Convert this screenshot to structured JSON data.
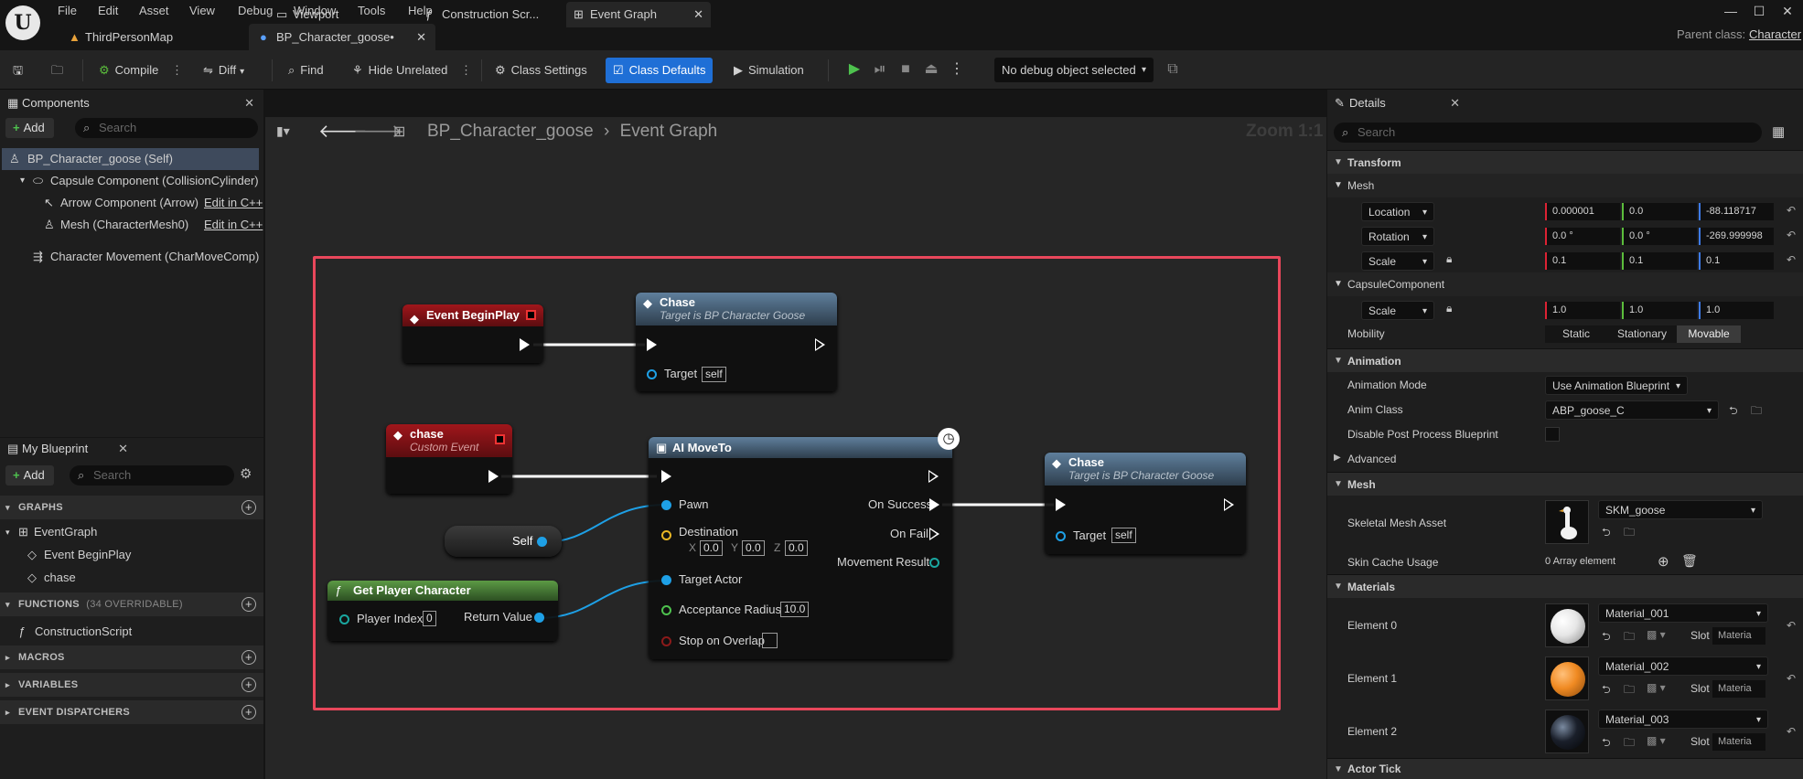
{
  "menu": [
    "File",
    "Edit",
    "Asset",
    "View",
    "Debug",
    "Window",
    "Tools",
    "Help"
  ],
  "tabs": [
    {
      "label": "ThirdPersonMap"
    },
    {
      "label": "BP_Character_goose•"
    }
  ],
  "parent_class": {
    "label": "Parent class:",
    "value": "Character"
  },
  "toolbar": {
    "compile": "Compile",
    "diff": "Diff",
    "find": "Find",
    "hide_unrelated": "Hide Unrelated",
    "class_settings": "Class Settings",
    "class_defaults": "Class Defaults",
    "simulation": "Simulation",
    "debug_object": "No debug object selected"
  },
  "components": {
    "tab": "Components",
    "add": "Add",
    "search_placeholder": "Search",
    "items": [
      {
        "label": "BP_Character_goose (Self)"
      },
      {
        "label": "Capsule Component (CollisionCylinder)"
      },
      {
        "label": "Arrow Component (Arrow)",
        "edit": "Edit in C++"
      },
      {
        "label": "Mesh (CharacterMesh0)",
        "edit": "Edit in C++"
      },
      {
        "label": "Character Movement (CharMoveComp)"
      }
    ]
  },
  "my_blueprint": {
    "tab": "My Blueprint",
    "add": "Add",
    "search_placeholder": "Search",
    "graphs_header": "GRAPHS",
    "event_graph": "EventGraph",
    "graph_items": [
      "Event BeginPlay",
      "chase"
    ],
    "functions_header": "FUNCTIONS",
    "functions_count": "(34 OVERRIDABLE)",
    "construction_script": "ConstructionScript",
    "macros_header": "MACROS",
    "variables_header": "VARIABLES",
    "dispatchers_header": "EVENT DISPATCHERS"
  },
  "graph_tabs": {
    "viewport": "Viewport",
    "construction": "Construction Scr...",
    "event_graph": "Event Graph"
  },
  "breadcrumb": {
    "blueprint": "BP_Character_goose",
    "sep": "›",
    "graph": "Event Graph"
  },
  "zoom": "Zoom 1:1",
  "nodes": {
    "begin_play": {
      "title": "Event BeginPlay"
    },
    "chase_call1": {
      "title": "Chase",
      "subtitle": "Target is BP Character Goose",
      "target_label": "Target",
      "target_value": "self"
    },
    "custom_event": {
      "title": "chase",
      "subtitle": "Custom Event"
    },
    "ai_moveto": {
      "title": "AI MoveTo",
      "pawn": "Pawn",
      "destination": "Destination",
      "dest_x_label": "X",
      "dest_x": "0.0",
      "dest_y_label": "Y",
      "dest_y": "0.0",
      "dest_z_label": "Z",
      "dest_z": "0.0",
      "target_actor": "Target Actor",
      "acceptance_radius": "Acceptance Radius",
      "acceptance_value": "10.0",
      "stop_on_overlap": "Stop on Overlap",
      "on_success": "On Success",
      "on_fail": "On Fail",
      "movement_result": "Movement Result"
    },
    "self_node": {
      "label": "Self"
    },
    "get_player": {
      "title": "Get Player Character",
      "player_index": "Player Index",
      "player_index_value": "0",
      "return_value": "Return Value"
    },
    "chase_call2": {
      "title": "Chase",
      "subtitle": "Target is BP Character Goose",
      "target_label": "Target",
      "target_value": "self"
    }
  },
  "details": {
    "tab": "Details",
    "search_placeholder": "Search",
    "transform": "Transform",
    "mesh_sub": "Mesh",
    "location": {
      "label": "Location",
      "x": "0.000001",
      "y": "0.0",
      "z": "-88.118717"
    },
    "rotation": {
      "label": "Rotation",
      "x": "0.0 °",
      "y": "0.0 °",
      "z": "-269.999998"
    },
    "scale": {
      "label": "Scale",
      "x": "0.1",
      "y": "0.1",
      "z": "0.1"
    },
    "capsule_sub": "CapsuleComponent",
    "capsule_scale": {
      "label": "Scale",
      "x": "1.0",
      "y": "1.0",
      "z": "1.0"
    },
    "mobility": {
      "label": "Mobility",
      "options": [
        "Static",
        "Stationary",
        "Movable"
      ],
      "selected": "Movable"
    },
    "animation": "Animation",
    "animation_mode": {
      "label": "Animation Mode",
      "value": "Use Animation Blueprint"
    },
    "anim_class": {
      "label": "Anim Class",
      "value": "ABP_goose_C"
    },
    "disable_post_process": "Disable Post Process Blueprint",
    "advanced": "Advanced",
    "mesh_section": "Mesh",
    "skeletal_mesh": {
      "label": "Skeletal Mesh Asset",
      "value": "SKM_goose"
    },
    "skin_cache": {
      "label": "Skin Cache Usage",
      "value": "0 Array element"
    },
    "materials": "Materials",
    "elements": [
      {
        "label": "Element 0",
        "value": "Material_001",
        "slot": "Slot",
        "slot_value": "Materia",
        "color": "#e6e6e6"
      },
      {
        "label": "Element 1",
        "value": "Material_002",
        "slot": "Slot",
        "slot_value": "Materia",
        "color": "#f08a22"
      },
      {
        "label": "Element 2",
        "value": "Material_003",
        "slot": "Slot",
        "slot_value": "Materia",
        "color": "#1a1f2a"
      }
    ],
    "actor_tick": "Actor Tick"
  },
  "colors": {
    "accent": "#1f6fd6",
    "selection": "#e8475b",
    "event_red": "#a0161b",
    "call_blue": "#4d6f8f",
    "pure_green": "#4d8a3a",
    "exec_wire": "#ffffff",
    "object_pin": "#1ea0e6"
  }
}
